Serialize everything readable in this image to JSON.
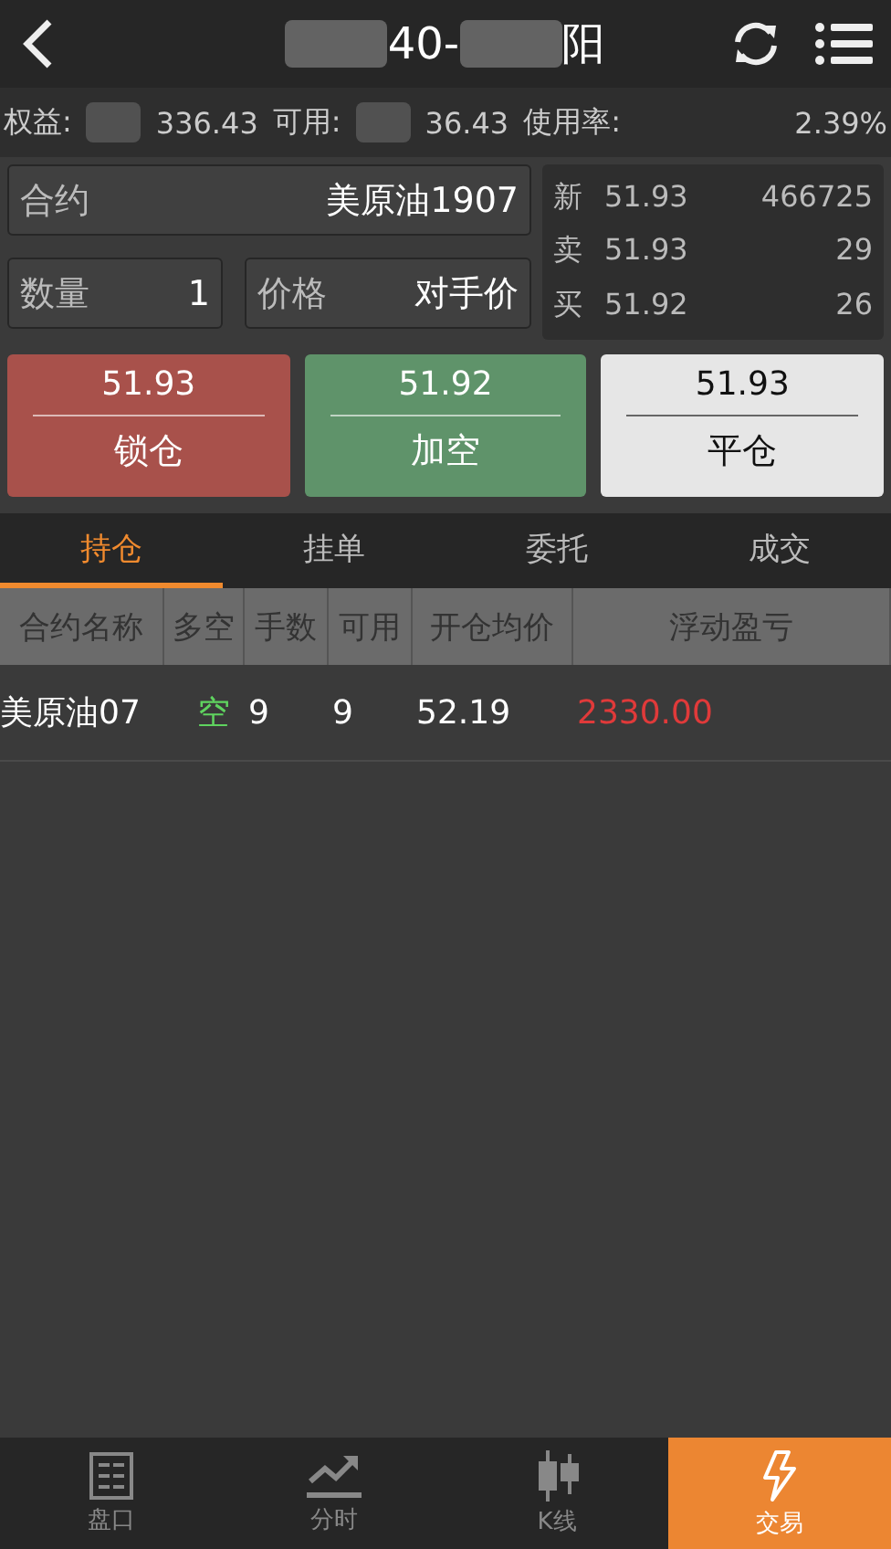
{
  "header": {
    "title_parts": [
      "40-",
      "阳"
    ]
  },
  "account": [
    {
      "label": "权益:",
      "value": "336.43"
    },
    {
      "label": "可用:",
      "value": "36.43"
    },
    {
      "label": "使用率:",
      "value": "2.39%"
    }
  ],
  "order": {
    "contract": {
      "label": "合约",
      "value": "美原油1907"
    },
    "quantity": {
      "label": "数量",
      "value": "1"
    },
    "price": {
      "label": "价格",
      "value": "对手价"
    }
  },
  "quotes": [
    {
      "label": "新",
      "price": "51.93",
      "volume": "466725"
    },
    {
      "label": "卖",
      "price": "51.93",
      "volume": "29"
    },
    {
      "label": "买",
      "price": "51.92",
      "volume": "26"
    }
  ],
  "actions": [
    {
      "kind": "red",
      "price": "51.93",
      "label": "锁仓"
    },
    {
      "kind": "green",
      "price": "51.92",
      "label": "加空"
    },
    {
      "kind": "light",
      "price": "51.93",
      "label": "平仓"
    }
  ],
  "tabs": [
    {
      "label": "持仓",
      "selected": true
    },
    {
      "label": "挂单",
      "selected": false
    },
    {
      "label": "委托",
      "selected": false
    },
    {
      "label": "成交",
      "selected": false
    }
  ],
  "table": {
    "columns": [
      "合约名称",
      "多空",
      "手数",
      "可用",
      "开仓均价",
      "浮动盈亏"
    ],
    "rows": [
      {
        "cells": [
          {
            "text": "美原油07"
          },
          {
            "text": "空",
            "color": "#5fd35f"
          },
          {
            "text": "9"
          },
          {
            "text": "9"
          },
          {
            "text": "52.19"
          },
          {
            "text": "2330.00",
            "color": "#e03a3a"
          }
        ]
      }
    ]
  },
  "nav": [
    {
      "label": "盘口",
      "selected": false
    },
    {
      "label": "分时",
      "selected": false
    },
    {
      "label": "K线",
      "selected": false
    },
    {
      "label": "交易",
      "selected": true
    }
  ]
}
